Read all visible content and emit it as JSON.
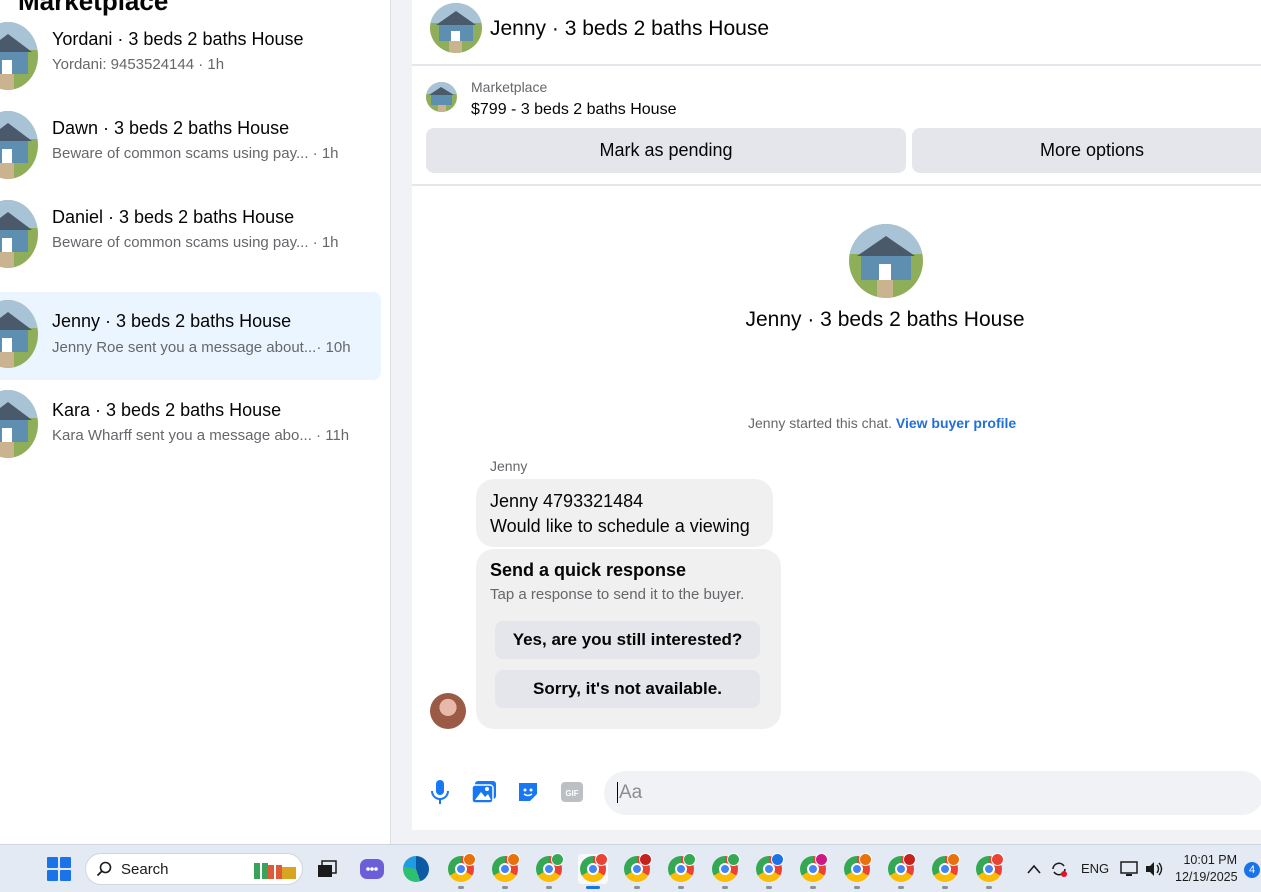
{
  "sidebar": {
    "title": "Marketplace",
    "conversations": [
      {
        "title": "Yordani · 3 beds 2 baths House",
        "subtitle": "Yordani: 9453524144 · 1h",
        "time": ""
      },
      {
        "title": "Dawn · 3 beds 2 baths House",
        "subtitle": "Beware of common scams using pay...",
        "time": "· 1h"
      },
      {
        "title": "Daniel · 3 beds 2 baths House",
        "subtitle": "Beware of common scams using pay...",
        "time": "· 1h"
      },
      {
        "title": "Jenny · 3 beds 2 baths House",
        "subtitle": "Jenny Roe sent you a message about...",
        "time": "· 10h"
      },
      {
        "title": "Kara · 3 beds 2 baths House",
        "subtitle": "Kara Wharff sent you a message abo...",
        "time": "· 11h"
      }
    ]
  },
  "chat": {
    "header_title": "Jenny · 3 beds 2 baths House",
    "listing": {
      "label": "Marketplace",
      "price_title": "$799 - 3 beds 2 baths House",
      "mark_pending": "Mark as pending",
      "more_options": "More options"
    },
    "intro_title": "Jenny · 3 beds 2 baths House",
    "started_text": "Jenny started this chat.",
    "view_buyer_profile": "View buyer profile",
    "sender_name": "Jenny",
    "message_line1": "Jenny 4793321484",
    "message_line2": "Would like to schedule a viewing",
    "quick_response": {
      "title": "Send a quick response",
      "subtitle": "Tap a response to send it to the buyer.",
      "yes": "Yes, are you still interested?",
      "no": "Sorry, it's not available."
    },
    "composer_placeholder": "Aa"
  },
  "taskbar": {
    "search_label": "Search",
    "language": "ENG",
    "time": "10:01 PM",
    "date": "12/19/2025",
    "notification_count": "4"
  },
  "colors": {
    "active_conversation": "#ebf5ff",
    "link": "#216fdb",
    "button_gray": "#e4e6eb"
  }
}
